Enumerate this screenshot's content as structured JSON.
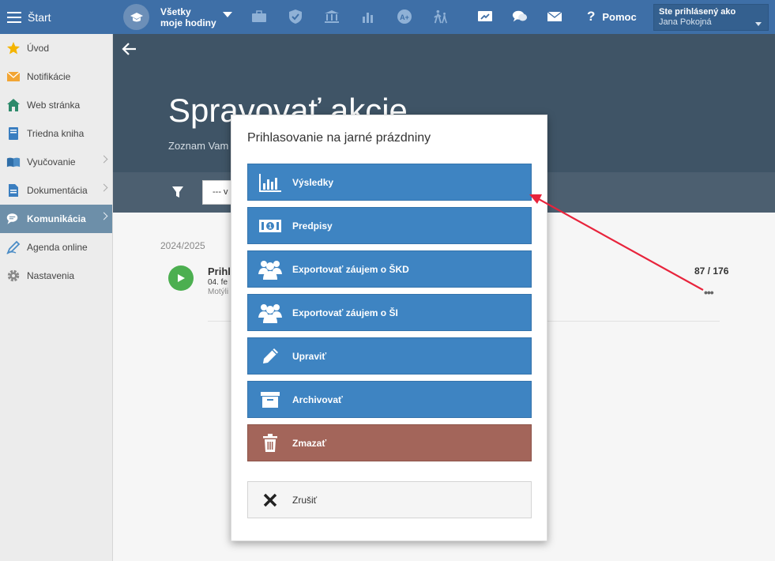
{
  "topbar": {
    "start_label": "Štart",
    "hours_line1": "Všetky",
    "hours_line2": "moje hodiny",
    "help_label": "Pomoc",
    "user_top": "Ste prihlásený ako",
    "user_name": "Jana Pokojná"
  },
  "sidebar": {
    "items": [
      {
        "label": "Úvod",
        "icon": "star-icon"
      },
      {
        "label": "Notifikácie",
        "icon": "envelope-icon"
      },
      {
        "label": "Web stránka",
        "icon": "house-icon"
      },
      {
        "label": "Triedna kniha",
        "icon": "book-icon"
      },
      {
        "label": "Vyučovanie",
        "icon": "open-book-icon"
      },
      {
        "label": "Dokumentácia",
        "icon": "document-icon"
      },
      {
        "label": "Komunikácia",
        "icon": "chat-icon"
      },
      {
        "label": "Agenda online",
        "icon": "pen-icon"
      },
      {
        "label": "Nastavenia",
        "icon": "gear-icon"
      }
    ]
  },
  "header": {
    "title": "Spravovať akcie",
    "subtitle": "Zoznam Vam"
  },
  "filter": {
    "select_value": "--- v"
  },
  "content": {
    "year": "2024/2025",
    "event_title": "Prihl",
    "event_date": "04. fe",
    "event_place": "Motýli",
    "event_count": "87 / 176",
    "event_more": "•••"
  },
  "modal": {
    "title": "Prihlasovanie na jarné prázdniny",
    "buttons": [
      {
        "label": "Výsledky",
        "icon": "bar-chart-icon"
      },
      {
        "label": "Predpisy",
        "icon": "money-icon"
      },
      {
        "label": "Exportovať záujem o ŠKD",
        "icon": "people-icon"
      },
      {
        "label": "Exportovať záujem o ŠI",
        "icon": "people-icon"
      },
      {
        "label": "Upraviť",
        "icon": "pencil-icon"
      },
      {
        "label": "Archivovať",
        "icon": "archive-icon"
      },
      {
        "label": "Zmazať",
        "icon": "trash-icon"
      },
      {
        "label": "Zrušiť",
        "icon": "close-icon"
      }
    ]
  },
  "colors": {
    "topbar": "#3e6fa7",
    "button_primary": "#3e84c2",
    "button_danger": "#a3655a",
    "annotation_arrow": "#e8243c"
  }
}
